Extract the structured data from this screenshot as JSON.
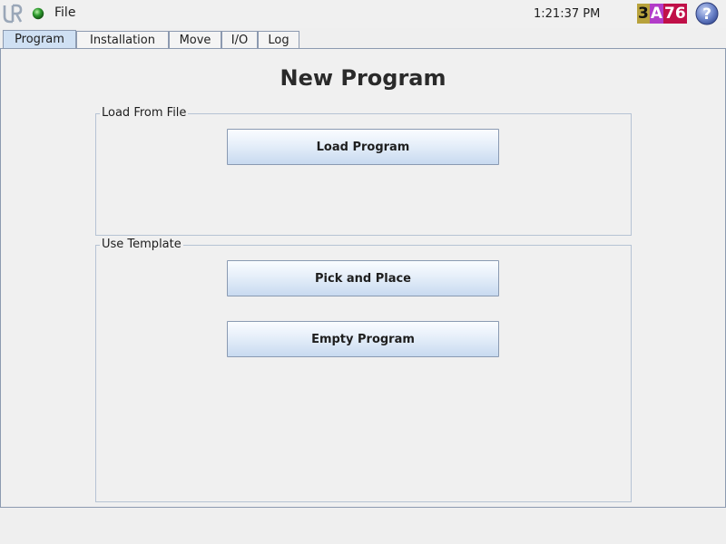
{
  "topbar": {
    "file_menu": "File",
    "clock": "1:21:37 PM",
    "version_parts": [
      "3",
      "A",
      "76"
    ],
    "status_color": "#2e9b2e",
    "logo_icon": "ur-logo-icon",
    "help_icon": "help-icon"
  },
  "tabs": [
    {
      "label": "Program",
      "active": true
    },
    {
      "label": "Installation",
      "active": false
    },
    {
      "label": "Move",
      "active": false
    },
    {
      "label": "I/O",
      "active": false
    },
    {
      "label": "Log",
      "active": false
    }
  ],
  "main": {
    "title": "New Program",
    "load_group": {
      "label": "Load From File",
      "load_button": "Load Program"
    },
    "template_group": {
      "label": "Use Template",
      "pick_place_button": "Pick and Place",
      "empty_button": "Empty Program"
    }
  },
  "colors": {
    "accent": "#cfe0f3",
    "border": "#8c9ab0"
  }
}
